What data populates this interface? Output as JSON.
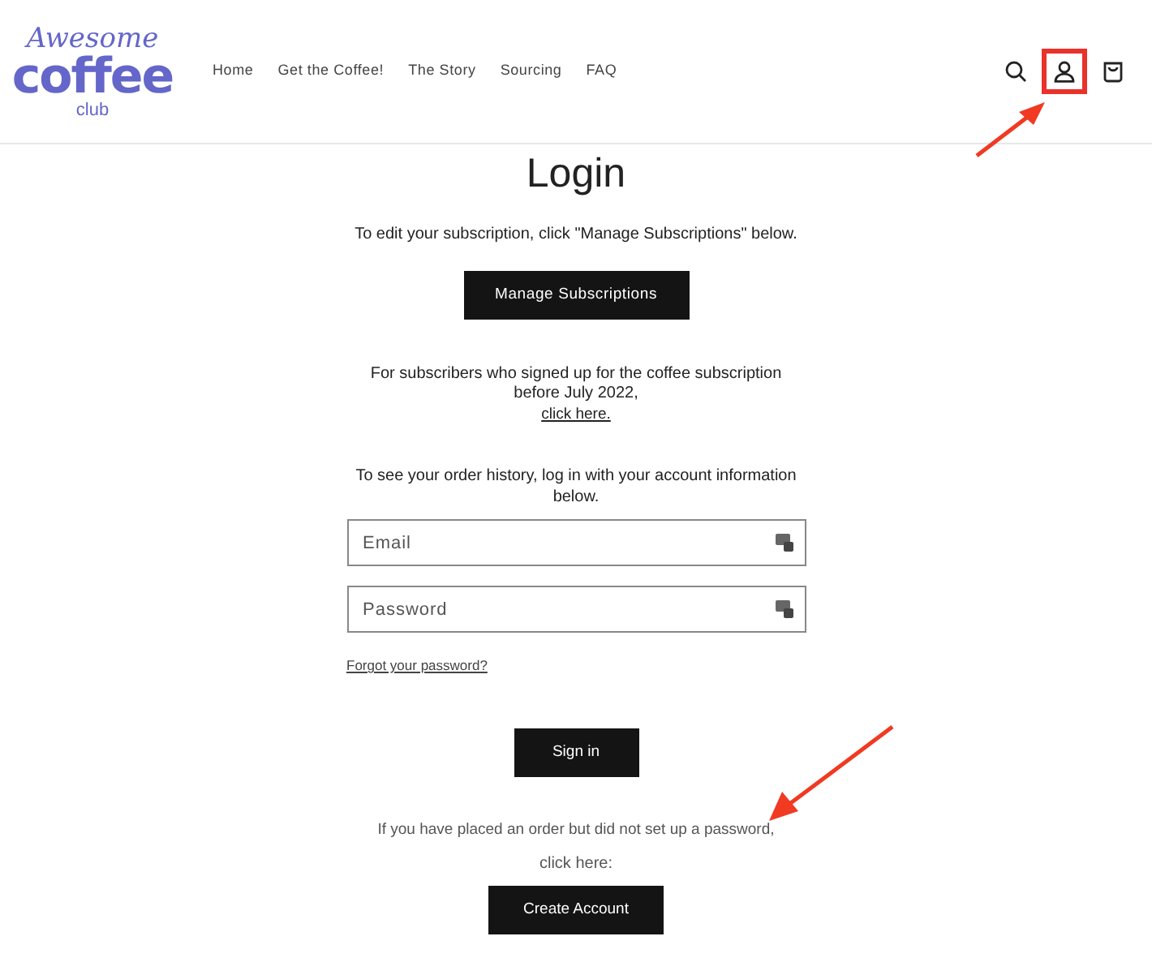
{
  "logo": {
    "line_1": "Awesome",
    "line_2": "coffee",
    "line_3": "club"
  },
  "nav": [
    "Home",
    "Get the Coffee!",
    "The Story",
    "Sourcing",
    "FAQ"
  ],
  "header_icons": [
    {
      "kind": "search",
      "highlighted": false
    },
    {
      "kind": "account",
      "highlighted": true
    },
    {
      "kind": "cart",
      "highlighted": false
    }
  ],
  "title": "Login",
  "manage_text": "To edit your subscription, click \"Manage Subscriptions\" below.",
  "manage_button": "Manage Subscriptions",
  "legacy_text": "For subscribers who signed up for the coffee subscription before July 2022,",
  "legacy_link": "click here.",
  "login_text": "To see your order history, log in with your account information below.",
  "fields": [
    {
      "placeholder": "Email"
    },
    {
      "placeholder": "Password"
    }
  ],
  "forgot_link": "Forgot your password?",
  "sign_in_button": "Sign in",
  "no_password_text": "If you have placed an order but did not set up a password,",
  "no_password_text_2": "click here:",
  "create_button": "Create Account"
}
